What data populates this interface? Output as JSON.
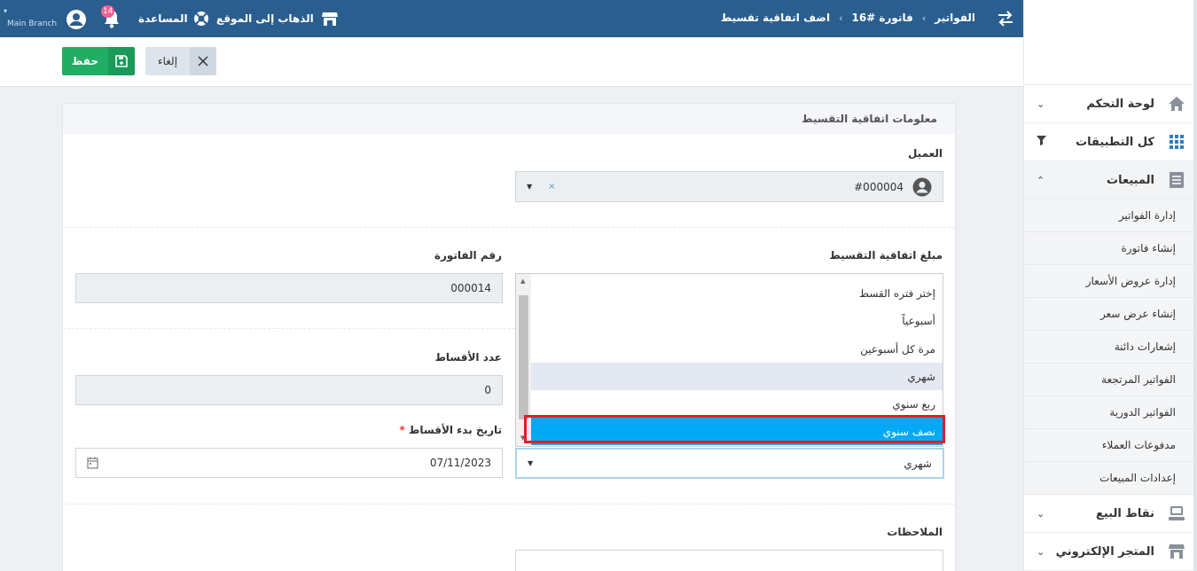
{
  "topbar": {
    "breadcrumbs": [
      "الفواتير",
      "فاتورة #16",
      "اضف اتفاقية تقسيط"
    ],
    "go_to_site": "الذهاب إلى الموقع",
    "help": "المساعدة",
    "notifications_count": "14",
    "branch": "Main Branch"
  },
  "actions": {
    "save": "حفظ",
    "cancel": "إلغاء"
  },
  "sidebar": {
    "items": [
      {
        "label": "لوحة التحكم",
        "icon": "home-icon"
      },
      {
        "label": "كل التطبيقات",
        "icon": "grid-icon"
      },
      {
        "label": "المبيعات",
        "icon": "sales-icon"
      }
    ],
    "sales_subitems": [
      "إدارة الفواتير",
      "إنشاء فاتورة",
      "إدارة عروض الأسعار",
      "إنشاء عرض سعر",
      "إشعارات دائنة",
      "الفواتير المرتجعة",
      "الفواتير الدورية",
      "مدفوعات العملاء",
      "إعدادات المبيعات"
    ],
    "bottom_items": [
      {
        "label": "نقاط البيع",
        "icon": "pos-icon"
      },
      {
        "label": "المتجر الإلكتروني",
        "icon": "store-icon"
      }
    ]
  },
  "form": {
    "section_title": "معلومات اتفاقية التقسيط",
    "client_label": "العميل",
    "client_value": "#000004",
    "installment_amount_label": "مبلغ اتفاقية التقسيط",
    "invoice_number_label": "رقم الفاتورة",
    "invoice_number_value": "000014",
    "installments_count_label": "عدد الأقساط",
    "installments_count_value": "0",
    "start_date_label": "تاريخ بدء الأقساط",
    "start_date_required": "*",
    "start_date_value": "07/11/2023",
    "period_value": "شهري",
    "notes_label": "الملاحظات"
  },
  "period_options": [
    "إختر فتره القسط",
    "أسبوعياً",
    "مرة كل أسبوعين",
    "شهري",
    "ربع سنوي",
    "نصف سنوي"
  ],
  "colors": {
    "topbar": "#2a5e8e",
    "save": "#22ad64",
    "selected_option": "#03a9f4",
    "highlight": "#e01e25"
  }
}
